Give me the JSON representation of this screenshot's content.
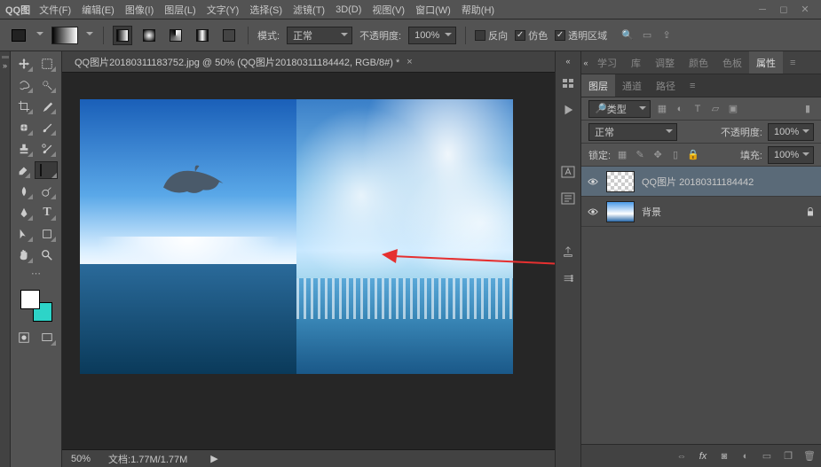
{
  "app_name": "QQ图",
  "menu": [
    "文件(F)",
    "编辑(E)",
    "图像(I)",
    "图层(L)",
    "文字(Y)",
    "选择(S)",
    "滤镜(T)",
    "3D(D)",
    "视图(V)",
    "窗口(W)",
    "帮助(H)"
  ],
  "optbar": {
    "mode_label": "模式:",
    "mode_value": "正常",
    "opacity_label": "不透明度:",
    "opacity_value": "100%",
    "chk_reverse": "反向",
    "chk_dither": "仿色",
    "chk_transp": "透明区域"
  },
  "doc_tab": "QQ图片20180311183752.jpg @ 50% (QQ图片20180311184442, RGB/8#) *",
  "status": {
    "zoom": "50%",
    "doc_label": "文档:",
    "doc_size": "1.77M/1.77M"
  },
  "panel_tabs_top": [
    "学习",
    "库",
    "调整",
    "颜色",
    "色板",
    "属性"
  ],
  "panel_tabs_layer": [
    "图层",
    "通道",
    "路径"
  ],
  "layer_panel": {
    "kind": "类型",
    "blend": "正常",
    "opacity_label": "不透明度:",
    "opacity_value": "100%",
    "lock_label": "锁定:",
    "fill_label": "填充:",
    "fill_value": "100%"
  },
  "layers": [
    {
      "name": "QQ图片 20180311184442"
    },
    {
      "name": "背景"
    }
  ]
}
